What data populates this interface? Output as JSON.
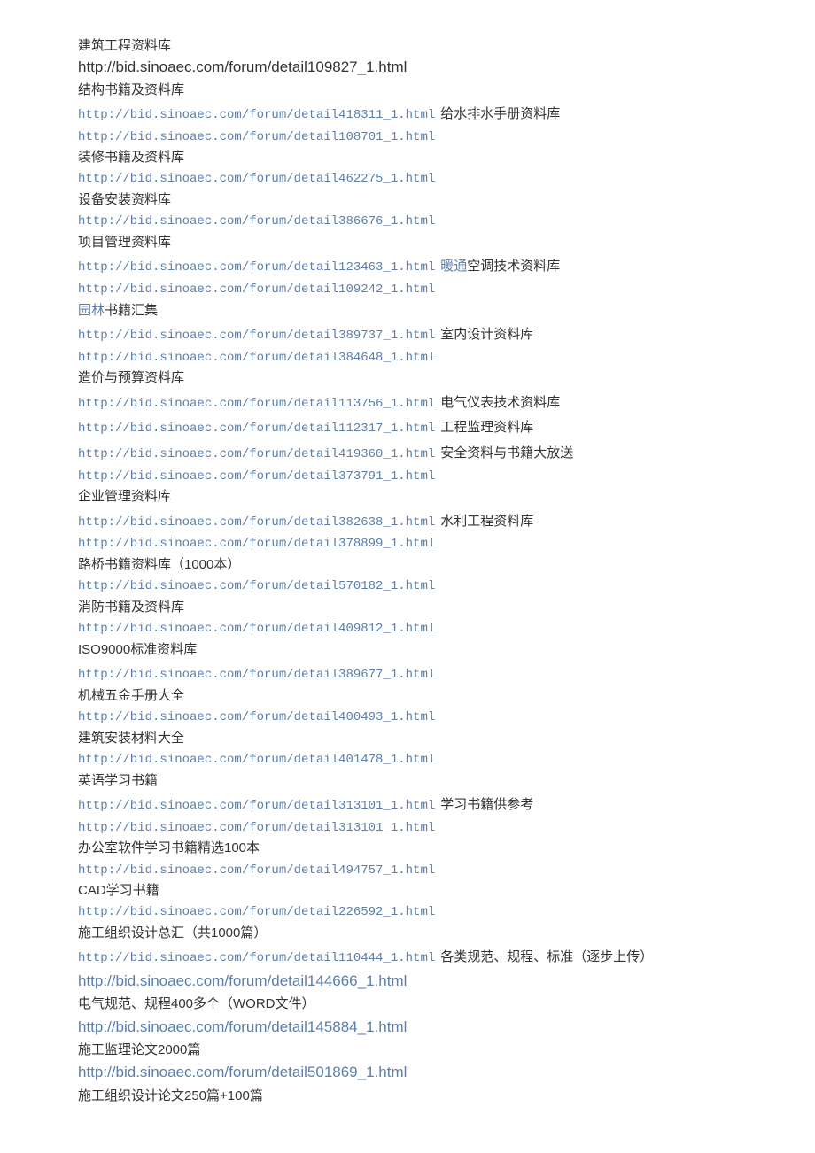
{
  "items": [
    {
      "kind": "heading",
      "text": "建筑工程资料库"
    },
    {
      "kind": "heading-large",
      "text": "http://bid.sinoaec.com/forum/detail109827_1.html"
    },
    {
      "kind": "heading",
      "text": "结构书籍及资料库"
    },
    {
      "kind": "gap"
    },
    {
      "kind": "link-with-text",
      "url": "http://bid.sinoaec.com/forum/detail418311_1.html",
      "after": "给水排水手册资料库"
    },
    {
      "kind": "link",
      "url": "http://bid.sinoaec.com/forum/detail108701_1.html"
    },
    {
      "kind": "heading",
      "text": "装修书籍及资料库"
    },
    {
      "kind": "link",
      "url": "http://bid.sinoaec.com/forum/detail462275_1.html"
    },
    {
      "kind": "heading",
      "text": "设备安装资料库"
    },
    {
      "kind": "link",
      "url": "http://bid.sinoaec.com/forum/detail386676_1.html"
    },
    {
      "kind": "heading",
      "text": "项目管理资料库"
    },
    {
      "kind": "gap"
    },
    {
      "kind": "link-with-mixed",
      "url": "http://bid.sinoaec.com/forum/detail123463_1.html",
      "hl": "暖通",
      "after": "空调技术资料库"
    },
    {
      "kind": "link",
      "url": "http://bid.sinoaec.com/forum/detail109242_1.html"
    },
    {
      "kind": "heading-mixed",
      "hl": "园林",
      "text": "书籍汇集"
    },
    {
      "kind": "gap"
    },
    {
      "kind": "link-with-text",
      "url": "http://bid.sinoaec.com/forum/detail389737_1.html",
      "after": "室内设计资料库"
    },
    {
      "kind": "link",
      "url": "http://bid.sinoaec.com/forum/detail384648_1.html"
    },
    {
      "kind": "heading",
      "text": "造价与预算资料库"
    },
    {
      "kind": "gap"
    },
    {
      "kind": "link-with-text",
      "url": "http://bid.sinoaec.com/forum/detail113756_1.html",
      "after": "电气仪表技术资料库"
    },
    {
      "kind": "gap"
    },
    {
      "kind": "link-with-text",
      "url": "http://bid.sinoaec.com/forum/detail112317_1.html",
      "after": "工程监理资料库"
    },
    {
      "kind": "gap"
    },
    {
      "kind": "link-with-text",
      "url": "http://bid.sinoaec.com/forum/detail419360_1.html",
      "after": "安全资料与书籍大放送"
    },
    {
      "kind": "link",
      "url": "http://bid.sinoaec.com/forum/detail373791_1.html"
    },
    {
      "kind": "heading",
      "text": "企业管理资料库"
    },
    {
      "kind": "gap"
    },
    {
      "kind": "link-with-text",
      "url": "http://bid.sinoaec.com/forum/detail382638_1.html",
      "after": "水利工程资料库"
    },
    {
      "kind": "link",
      "url": "http://bid.sinoaec.com/forum/detail378899_1.html"
    },
    {
      "kind": "heading",
      "text": "路桥书籍资料库（1000本）"
    },
    {
      "kind": "link",
      "url": "http://bid.sinoaec.com/forum/detail570182_1.html"
    },
    {
      "kind": "heading",
      "text": "消防书籍及资料库"
    },
    {
      "kind": "link",
      "url": "http://bid.sinoaec.com/forum/detail409812_1.html"
    },
    {
      "kind": "heading",
      "text": "ISO9000标准资料库"
    },
    {
      "kind": "gap"
    },
    {
      "kind": "link",
      "url": "http://bid.sinoaec.com/forum/detail389677_1.html"
    },
    {
      "kind": "heading",
      "text": "机械五金手册大全"
    },
    {
      "kind": "link",
      "url": "http://bid.sinoaec.com/forum/detail400493_1.html"
    },
    {
      "kind": "heading",
      "text": "建筑安装材料大全"
    },
    {
      "kind": "link",
      "url": "http://bid.sinoaec.com/forum/detail401478_1.html"
    },
    {
      "kind": "heading",
      "text": "英语学习书籍"
    },
    {
      "kind": "gap"
    },
    {
      "kind": "link-with-text",
      "url": "http://bid.sinoaec.com/forum/detail313101_1.html",
      "after": "学习书籍供参考"
    },
    {
      "kind": "link",
      "url": "http://bid.sinoaec.com/forum/detail313101_1.html"
    },
    {
      "kind": "heading",
      "text": "办公室软件学习书籍精选100本"
    },
    {
      "kind": "link",
      "url": "http://bid.sinoaec.com/forum/detail494757_1.html"
    },
    {
      "kind": "heading",
      "text": "CAD学习书籍"
    },
    {
      "kind": "link",
      "url": "http://bid.sinoaec.com/forum/detail226592_1.html"
    },
    {
      "kind": "heading",
      "text": "施工组织设计总汇（共1000篇）"
    },
    {
      "kind": "gap"
    },
    {
      "kind": "link-with-text",
      "url": "http://bid.sinoaec.com/forum/detail110444_1.html",
      "after": "各类规范、规程、标准（逐步上传）"
    },
    {
      "kind": "link-sans",
      "url": "http://bid.sinoaec.com/forum/detail144666_1.html"
    },
    {
      "kind": "heading",
      "text": "电气规范、规程400多个（WORD文件）"
    },
    {
      "kind": "link-sans",
      "url": "http://bid.sinoaec.com/forum/detail145884_1.html"
    },
    {
      "kind": "heading",
      "text": "施工监理论文2000篇"
    },
    {
      "kind": "link-sans",
      "url": "http://bid.sinoaec.com/forum/detail501869_1.html"
    },
    {
      "kind": "heading",
      "text": "施工组织设计论文250篇+100篇"
    }
  ]
}
